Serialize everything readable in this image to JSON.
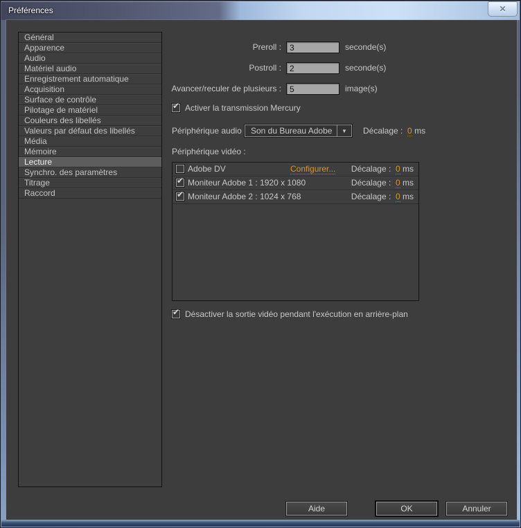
{
  "window": {
    "title": "Préférences"
  },
  "icons": {
    "close": "✕",
    "dropdown_arrow": "▼",
    "check": "✔"
  },
  "colors": {
    "accent_orange": "#d9942f",
    "client_bg": "#3d3d3d",
    "selection_bg": "#5d5d5d"
  },
  "sidebar": {
    "selected": "Lecture",
    "items": [
      "Général",
      "Apparence",
      "Audio",
      "Matériel audio",
      "Enregistrement automatique",
      "Acquisition",
      "Surface de contrôle",
      "Pilotage de matériel",
      "Couleurs des libellés",
      "Valeurs par défaut des libellés",
      "Média",
      "Mémoire",
      "Lecture",
      "Synchro. des paramètres",
      "Titrage",
      "Raccord"
    ]
  },
  "form": {
    "preroll": {
      "label": "Preroll :",
      "value": "3",
      "unit": "seconde(s)"
    },
    "postroll": {
      "label": "Postroll :",
      "value": "2",
      "unit": "seconde(s)"
    },
    "step": {
      "label": "Avancer/reculer de plusieurs :",
      "value": "5",
      "unit": "image(s)"
    },
    "mercury": {
      "label": "Activer la transmission Mercury",
      "checked": true
    },
    "audio_device": {
      "label": "Périphérique audio :",
      "value": "Son du Bureau Adobe",
      "offset_label": "Décalage :",
      "offset_value": "0",
      "offset_unit": "ms"
    },
    "video_device_label": "Périphérique vidéo :",
    "video_devices": [
      {
        "name": "Adobe DV",
        "checked": false,
        "configure_label": "Configurer...",
        "offset_label": "Décalage :",
        "offset_value": "0",
        "offset_unit": "ms"
      },
      {
        "name": "Moniteur Adobe 1 : 1920 x 1080",
        "checked": true,
        "offset_label": "Décalage :",
        "offset_value": "0",
        "offset_unit": "ms"
      },
      {
        "name": "Moniteur Adobe 2 : 1024 x 768",
        "checked": true,
        "offset_label": "Décalage :",
        "offset_value": "0",
        "offset_unit": "ms"
      }
    ],
    "disable_bg": {
      "label": "Désactiver la sortie vidéo pendant l'exécution en arrière-plan",
      "checked": true
    }
  },
  "buttons": {
    "help": "Aide",
    "ok": "OK",
    "cancel": "Annuler"
  }
}
